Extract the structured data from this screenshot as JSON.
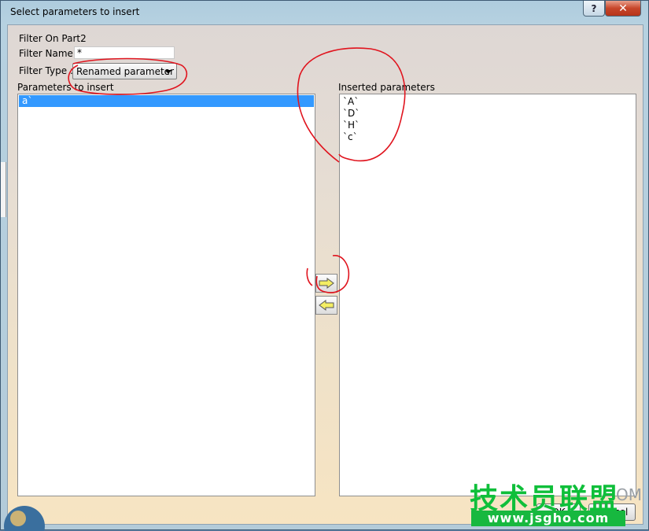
{
  "window": {
    "title": "Select parameters to insert",
    "help_label": "?",
    "close_label": "✕"
  },
  "filter": {
    "on_label": "Filter On Part2",
    "name_label": "Filter Name :",
    "name_value": "*",
    "type_label": "Filter Type :",
    "type_value": "Renamed parameter"
  },
  "left_list": {
    "header": "Parameters to insert",
    "items": [
      "a`"
    ],
    "selected_index": 0
  },
  "right_list": {
    "header": "Inserted parameters",
    "items": [
      "`A`",
      "`D`",
      "`H`",
      "`c`"
    ]
  },
  "buttons": {
    "insert_icon": "right-arrow-icon",
    "remove_icon": "left-arrow-icon",
    "ok_label": "OK",
    "cancel_label": "Cancel"
  },
  "watermark": {
    "chinese": "技术员联盟",
    "com": "OM",
    "url": "www.jsgho.com"
  },
  "colors": {
    "selection": "#3399ff",
    "annotation": "#e0141e",
    "watermark_green": "#17b83f"
  }
}
